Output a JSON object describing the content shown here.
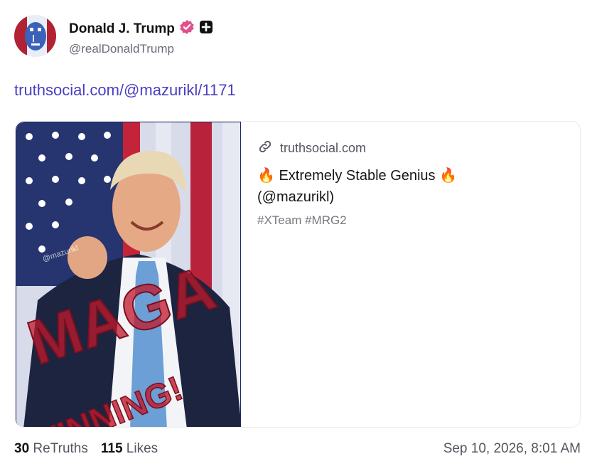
{
  "author": {
    "name": "Donald J. Trump",
    "handle": "@realDonaldTrump",
    "verified_icon": "verified-badge-icon",
    "extra_badge_icon": "plus-badge-icon"
  },
  "post": {
    "link_text": "truthsocial.com/@mazurikl/1171"
  },
  "link_card": {
    "domain": "truthsocial.com",
    "title_line1": "🔥 Extremely Stable Genius 🔥",
    "title_line2": "(@mazurikl)",
    "tags": "#XTeam #MRG2",
    "image_overlay_line1": "MAGA",
    "image_overlay_line2": "WINNING!",
    "image_watermark": "@mazurikl"
  },
  "stats": {
    "retruths_count": "30",
    "retruths_label": "ReTruths",
    "likes_count": "115",
    "likes_label": "Likes"
  },
  "timestamp": "Sep 10, 2026, 8:01 AM",
  "colors": {
    "link": "#4a3fc1",
    "verified": "#e0508c",
    "muted": "#55555f"
  }
}
